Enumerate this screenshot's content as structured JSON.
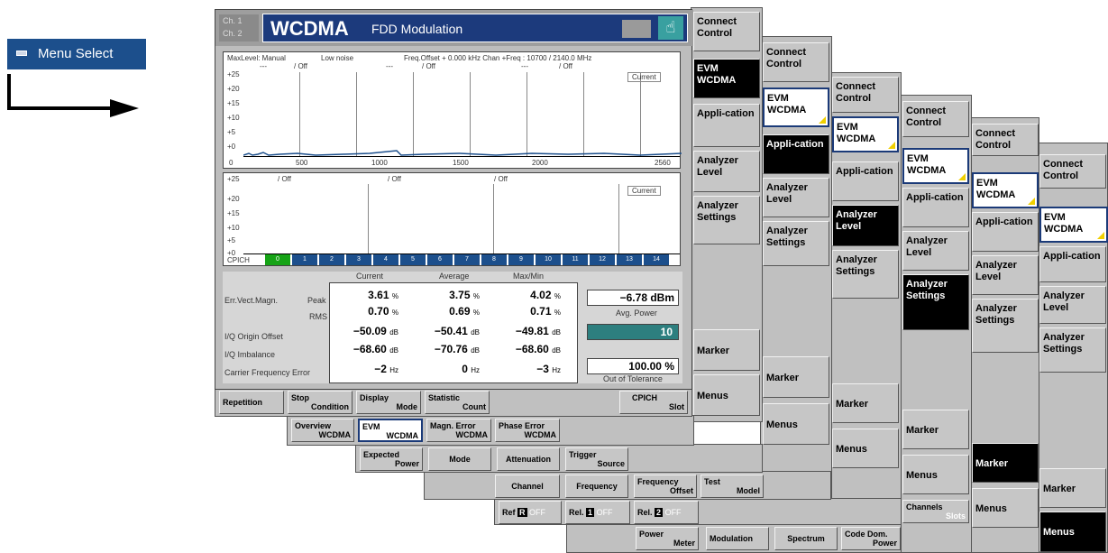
{
  "menu_select": {
    "label": "Menu Select",
    "icon": "menu-icon"
  },
  "instrument": {
    "channels": [
      "Ch. 1",
      "Ch. 2"
    ],
    "title": "WCDMA",
    "subtitle": "FDD  Modulation",
    "diagram": {
      "header_left": "MaxLevel: Manual",
      "header_mid": "Low noise",
      "header_right": "Freq.Offset + 0.000 kHz  Chan +Freq : 10700 / 2140.0 MHz",
      "marker_row1": [
        "---",
        "/ Off",
        "---",
        "/ Off",
        "---",
        "/ Off"
      ],
      "marker_row2": [
        "/ Off",
        "/ Off",
        "/ Off"
      ],
      "current": "Current",
      "y_labels": [
        "+25",
        "+20",
        "+15",
        "+10",
        "+5",
        "+0"
      ],
      "x_labels": [
        "0",
        "500",
        "1000",
        "1500",
        "2000",
        "2560"
      ],
      "cpich_label": "CPICH",
      "slots": [
        "0",
        "1",
        "2",
        "3",
        "4",
        "5",
        "6",
        "7",
        "8",
        "9",
        "10",
        "11",
        "12",
        "13",
        "14"
      ]
    },
    "results": {
      "headers": [
        "Current",
        "Average",
        "Max/Min"
      ],
      "row_labels": [
        "Err.Vect.Magn.",
        "Peak",
        "RMS",
        "I/Q Origin Offset",
        "I/Q Imbalance",
        "Carrier Frequency Error"
      ],
      "rows": [
        {
          "cur": "3.61",
          "avg": "3.75",
          "max": "4.02",
          "unit": "%"
        },
        {
          "cur": "0.70",
          "avg": "0.69",
          "max": "0.71",
          "unit": "%"
        },
        {
          "cur": "−50.09",
          "avg": "−50.41",
          "max": "−49.81",
          "unit": "dB"
        },
        {
          "cur": "−68.60",
          "avg": "−70.76",
          "max": "−68.60",
          "unit": "dB"
        },
        {
          "cur": "−2",
          "avg": "0",
          "max": "−3",
          "unit": "Hz"
        }
      ],
      "power_value": "−6.78 dBm",
      "power_label": "Avg. Power",
      "count_value": "10",
      "tolerance_value": "100.00 %",
      "tolerance_label": "Out of Tolerance"
    },
    "buttons_row1": [
      {
        "top": "Repetition",
        "bottom": ""
      },
      {
        "top": "Stop",
        "bottom": "Condition"
      },
      {
        "top": "Display",
        "bottom": "Mode"
      },
      {
        "top": "Statistic",
        "bottom": "Count"
      },
      {
        "top": "CPICH",
        "bottom": "Slot"
      }
    ],
    "buttons_row2": [
      {
        "top": "Overview",
        "bottom": "WCDMA"
      },
      {
        "top": "EVM",
        "bottom": "WCDMA"
      },
      {
        "top": "Magn. Error",
        "bottom": "WCDMA"
      },
      {
        "top": "Phase Error",
        "bottom": "WCDMA"
      }
    ],
    "buttons_row3": [
      {
        "top": "Expected",
        "bottom": "Power"
      },
      {
        "top": "Mode",
        "bottom": ""
      },
      {
        "top": "Attenuation",
        "bottom": ""
      },
      {
        "top": "Trigger",
        "bottom": "Source"
      }
    ],
    "buttons_row4": [
      {
        "top": "Channel",
        "bottom": ""
      },
      {
        "top": "Frequency",
        "bottom": ""
      },
      {
        "top": "Frequency",
        "bottom": "Offset"
      },
      {
        "top": "Test",
        "bottom": "Model"
      }
    ],
    "buttons_row5": [
      "Ref",
      "Rel.",
      "Rel."
    ],
    "off": "OFF",
    "channels_slots": {
      "top": "Channels",
      "bottom": "Slots"
    },
    "buttons_row6": [
      {
        "top": "Power",
        "bottom": "Meter"
      },
      {
        "top": "Modulation",
        "bottom": ""
      },
      {
        "top": "Spectrum",
        "bottom": ""
      },
      {
        "top": "Code Dom.",
        "bottom": "Power"
      }
    ]
  },
  "softkeys": {
    "connect": "Connect Control",
    "evm": "EVM WCDMA",
    "application": "Appli-cation",
    "analyzer_level": "Analyzer Level",
    "analyzer_settings": "Analyzer Settings",
    "marker": "Marker",
    "menus": "Menus"
  },
  "colors": {
    "title_blue": "#1c3a7c",
    "slot_green": "#16a316",
    "slot_blue": "#1c4f8c",
    "ok_teal": "#2d7f7f"
  }
}
